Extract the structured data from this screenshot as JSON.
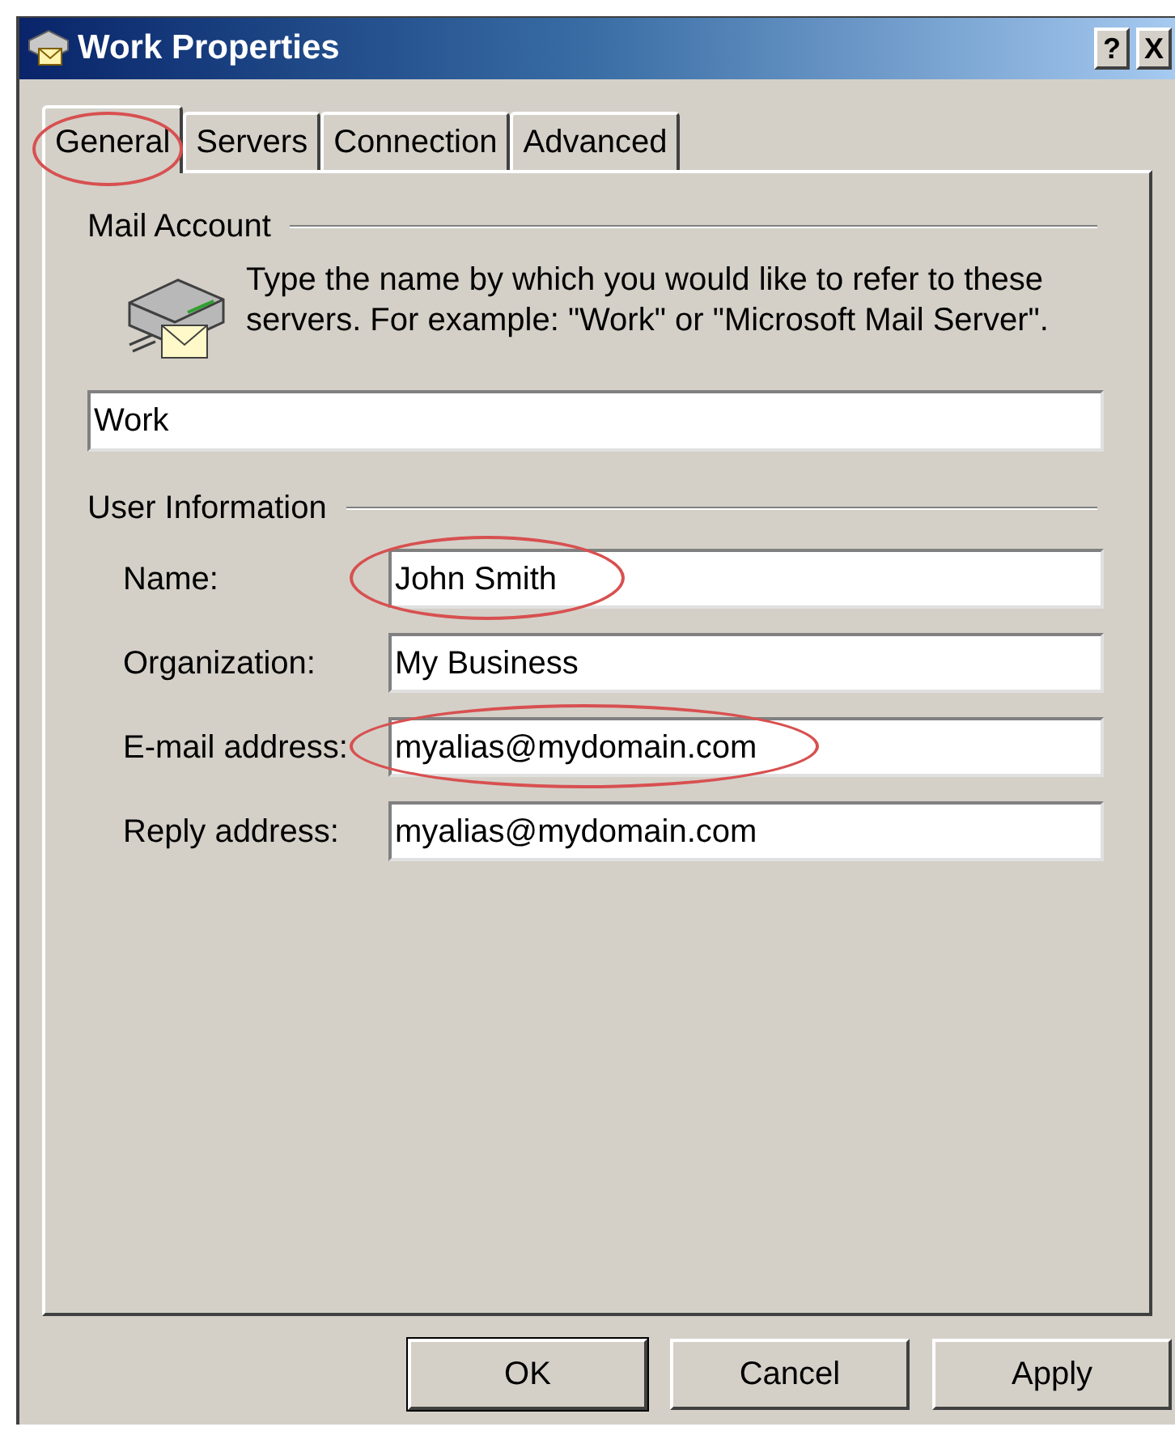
{
  "window": {
    "title": "Work Properties",
    "buttons": [
      "?",
      "X"
    ]
  },
  "tabs": [
    {
      "label": "General",
      "selected": true,
      "highlighted": true
    },
    {
      "label": "Servers",
      "selected": false,
      "highlighted": false
    },
    {
      "label": "Connection",
      "selected": false,
      "highlighted": false
    },
    {
      "label": "Advanced",
      "selected": false,
      "highlighted": false
    }
  ],
  "mail_account": {
    "heading": "Mail Account",
    "description": "Type the name by which you would like to refer to these servers.  For example: \"Work\" or \"Microsoft Mail Server\".",
    "value": "Work"
  },
  "user_information": {
    "heading": "User Information",
    "fields": [
      {
        "label": "Name:",
        "value": "John Smith",
        "highlighted": true
      },
      {
        "label": "Organization:",
        "value": "My Business",
        "highlighted": false
      },
      {
        "label": "E-mail address:",
        "value": "myalias@mydomain.com",
        "highlighted": true
      },
      {
        "label": "Reply address:",
        "value": "myalias@mydomain.com",
        "highlighted": false
      }
    ]
  },
  "buttons": [
    {
      "label": "OK",
      "default": true
    },
    {
      "label": "Cancel",
      "default": false
    },
    {
      "label": "Apply",
      "default": false
    }
  ]
}
